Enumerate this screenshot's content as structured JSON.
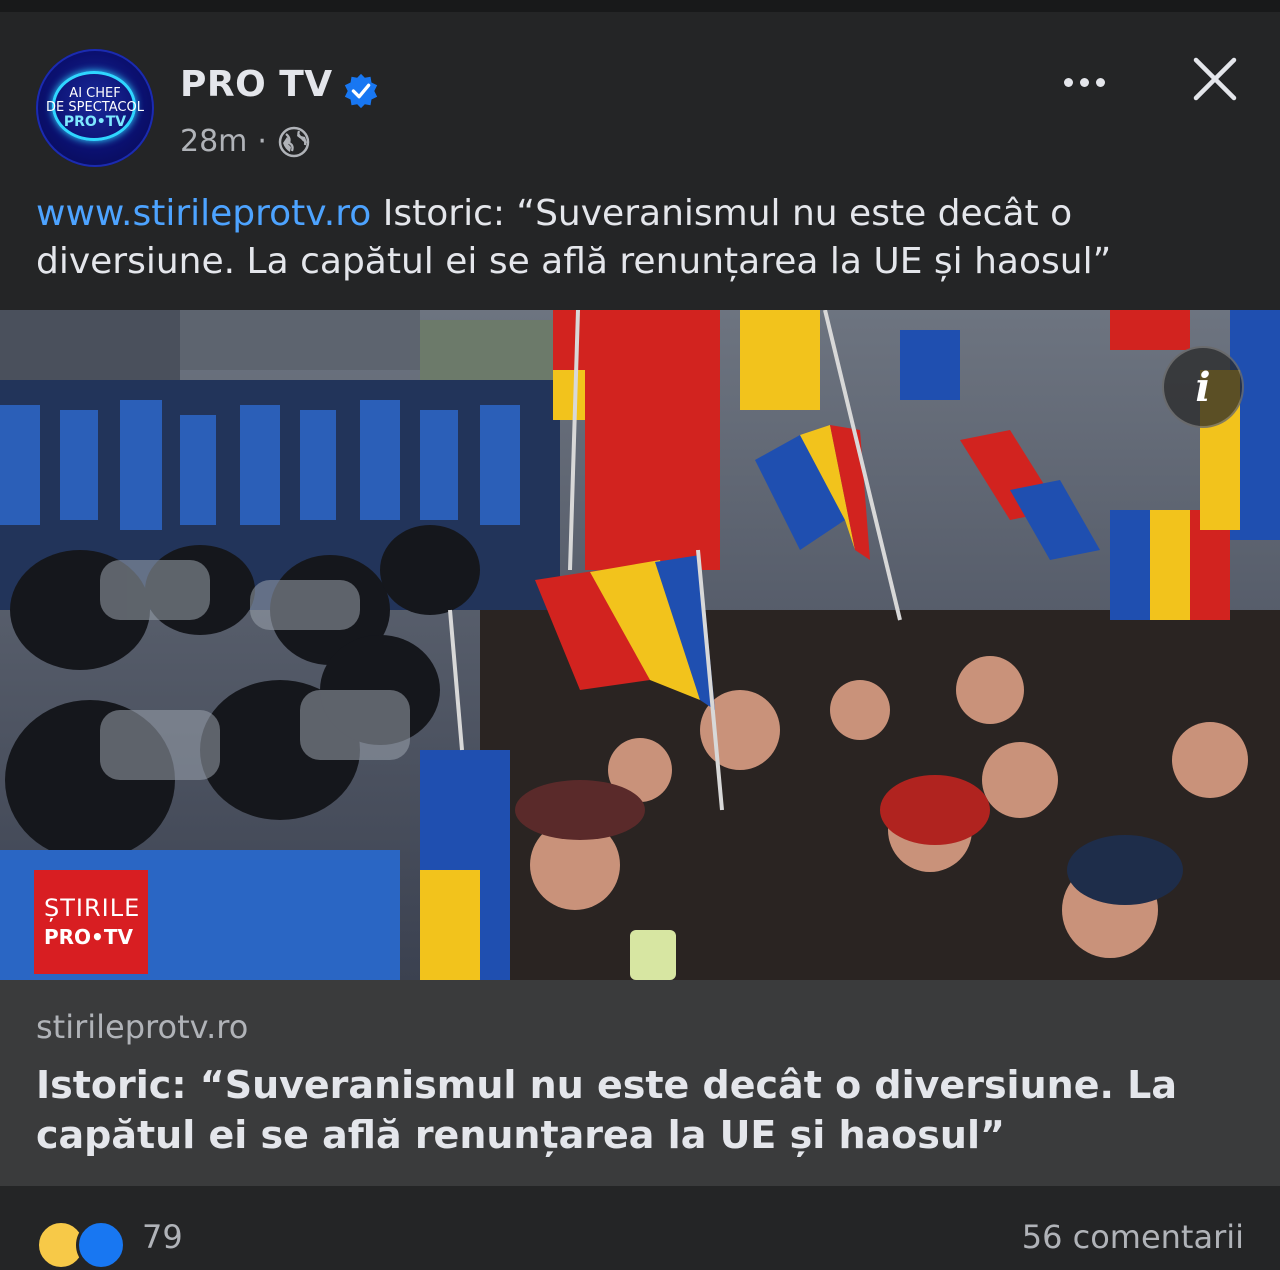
{
  "post": {
    "avatar": {
      "line1": "AI CHEF",
      "line2": "DE SPECTACOL",
      "line3": "PRO•TV"
    },
    "page_name": "PRO TV",
    "time": "28m",
    "separator": "·",
    "link_prefix": "www.stirileprotv.ro",
    "text": "Istoric: “Suveranismul nu este decât o diversiune. La capătul ei se află renunțarea la UE și haosul”",
    "icons": {
      "verified": "verified-badge-icon",
      "privacy": "globe-icon",
      "more": "more-dots-icon",
      "close": "close-icon",
      "info": "info-icon"
    }
  },
  "photo": {
    "info_label": "i",
    "watermark_line1": "ȘTIRILE",
    "watermark_line2": "PRO•TV"
  },
  "link_card": {
    "domain": "stirileprotv.ro",
    "title": "Istoric: “Suveranismul nu este decât o diversiune. La capătul ei se află renunțarea la UE și haosul”"
  },
  "footer": {
    "reaction_count": "79",
    "comments": "56 comentarii"
  },
  "colors": {
    "background": "#242526",
    "card": "#3a3b3c",
    "link": "#4da3ff",
    "verified": "#1877f2",
    "watermark": "#d81e22"
  }
}
